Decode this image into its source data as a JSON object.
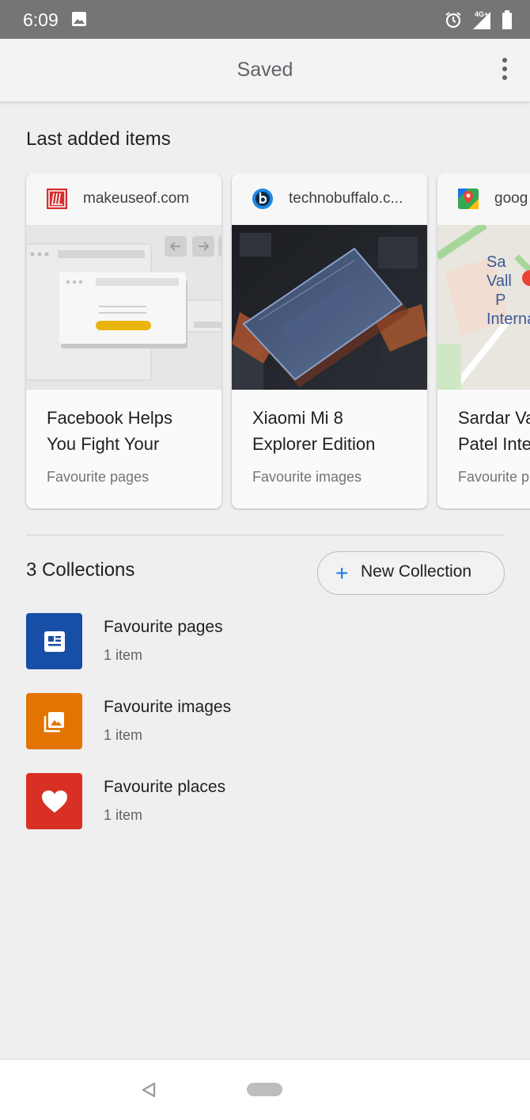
{
  "status_bar": {
    "time": "6:09",
    "network": "4G+",
    "icons": [
      "image-icon",
      "alarm-icon",
      "signal-icon",
      "battery-icon"
    ]
  },
  "app_bar": {
    "title": "Saved",
    "more_icon": "more-vert-icon"
  },
  "last_added": {
    "heading": "Last added items",
    "cards": [
      {
        "domain": "makeuseof.com",
        "favicon": "makeuseof-icon",
        "title_line1": "Facebook Helps",
        "title_line2": "You Fight Your",
        "collection": "Favourite pages"
      },
      {
        "domain": "technobuffalo.c...",
        "favicon": "technobuffalo-icon",
        "title_line1": "Xiaomi Mi 8",
        "title_line2": "Explorer Edition",
        "collection": "Favourite images"
      },
      {
        "domain": "goog",
        "favicon": "google-maps-icon",
        "title_line1": "Sardar Va",
        "title_line2": "Patel Inte",
        "collection": "Favourite p"
      }
    ]
  },
  "collections": {
    "count_label": "3 Collections",
    "new_button_label": "New Collection",
    "items": [
      {
        "name": "Favourite pages",
        "count": "1 item",
        "color": "#174ea6",
        "icon": "article-icon"
      },
      {
        "name": "Favourite images",
        "count": "1 item",
        "color": "#e37400",
        "icon": "photo-library-icon"
      },
      {
        "name": "Favourite places",
        "count": "1 item",
        "color": "#d93025",
        "icon": "heart-icon"
      }
    ]
  },
  "nav_bar": {
    "icons": [
      "back-icon",
      "home-pill"
    ]
  }
}
